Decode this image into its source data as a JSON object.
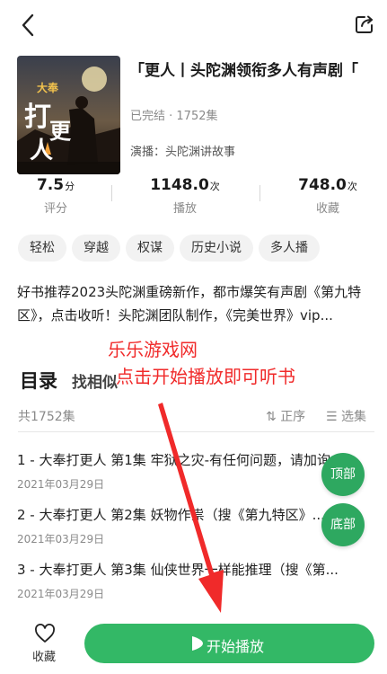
{
  "header": {
    "back_icon": "back-chevron-icon",
    "share_icon": "share-icon"
  },
  "book": {
    "title": "「更人丨头陀渊领衔多人有声剧「",
    "status": "已完结 · 1752集",
    "narrator": "演播：头陀渊讲故事",
    "cover_lines": {
      "big": "打更人",
      "small": "大奉"
    }
  },
  "stats": [
    {
      "value": "7.5",
      "unit": "分",
      "label": "评分"
    },
    {
      "value": "1148.0",
      "unit": "次",
      "label": "播放"
    },
    {
      "value": "748.0",
      "unit": "次",
      "label": "收藏"
    }
  ],
  "tags": [
    "轻松",
    "穿越",
    "权谋",
    "历史小说",
    "多人播"
  ],
  "description": "好书推荐2023头陀渊重磅新作，都市爆笑有声剧《第九特区》，点击收听！头陀渊团队制作，《完美世界》vip...",
  "toc": {
    "title": "目录",
    "similar": "找相似",
    "total": "共1752集",
    "sort": "正序",
    "select": "选集"
  },
  "overlay": {
    "line1": "乐乐游戏网",
    "line2": "点击开始播放即可听书",
    "color": "#f02a2a"
  },
  "episodes": [
    {
      "title": "1 - 大奉打更人 第1集 牢狱之灾-有任何问题，请加询...",
      "date": "2021年03月29日"
    },
    {
      "title": "2 - 大奉打更人 第2集 妖物作祟（搜《第九特区》...",
      "date": "2021年03月29日"
    },
    {
      "title": "3 - 大奉打更人 第3集 仙侠世界一样能推理（搜《第...",
      "date": "2021年03月29日"
    }
  ],
  "floating": {
    "top": "顶部",
    "bottom": "底部"
  },
  "bottom_bar": {
    "favorite": "收藏",
    "play": "开始播放"
  },
  "colors": {
    "accent": "#33b866",
    "float": "#2ea860"
  }
}
